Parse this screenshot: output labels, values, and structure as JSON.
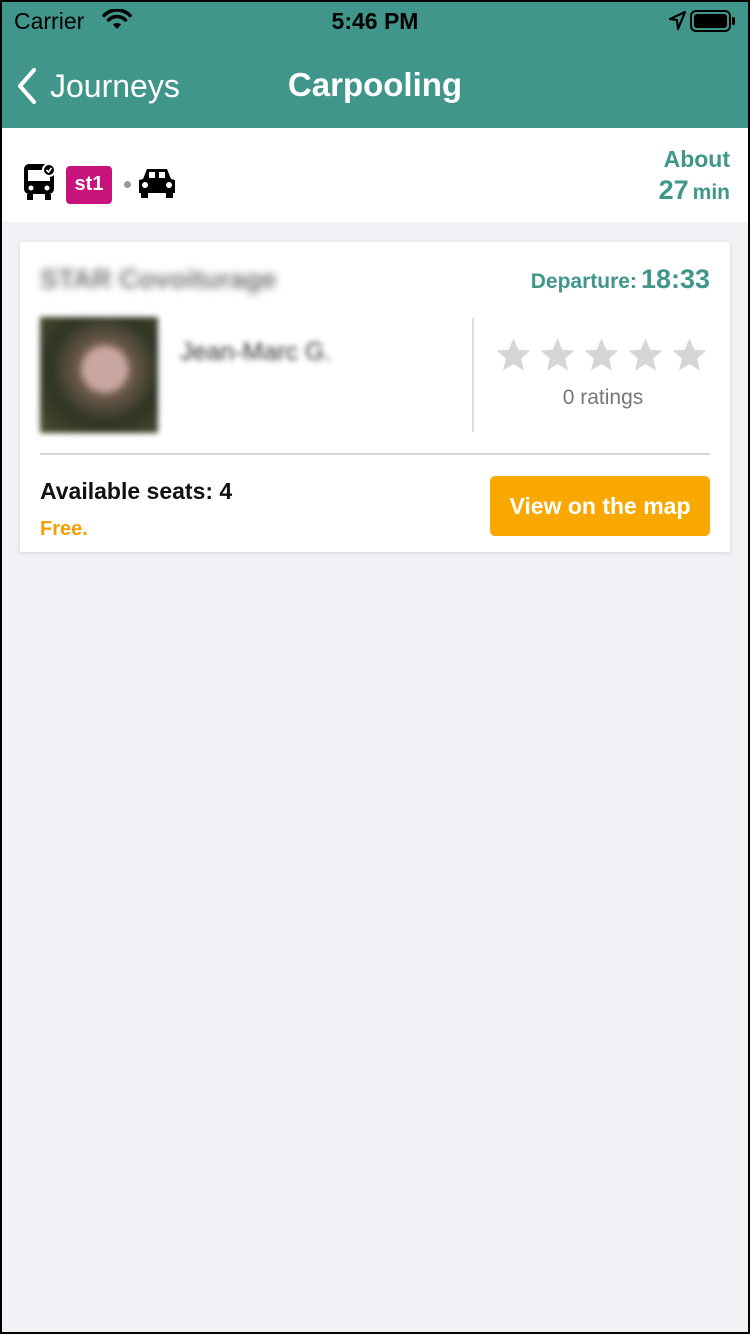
{
  "status_bar": {
    "carrier": "Carrier",
    "time": "5:46 PM"
  },
  "nav": {
    "back_label": "Journeys",
    "title": "Carpooling"
  },
  "journey": {
    "modes": [
      "bus-icon",
      "car-icon"
    ],
    "line_badge": "st1",
    "line_color": "#c8127c",
    "duration_prefix": "About",
    "duration_value": "27",
    "duration_unit": "min"
  },
  "offer": {
    "operator": "STAR Covoiturage",
    "departure_label": "Departure:",
    "departure_time": "18:33",
    "driver_name": "Jean-Marc G.",
    "rating_stars": 0,
    "rating_max": 5,
    "ratings_text": "0 ratings",
    "seats_text": "Available seats: 4",
    "price_text": "Free.",
    "map_button": "View on the map"
  },
  "colors": {
    "accent": "#41968b",
    "button": "#f8a800",
    "price": "#f5a000"
  }
}
